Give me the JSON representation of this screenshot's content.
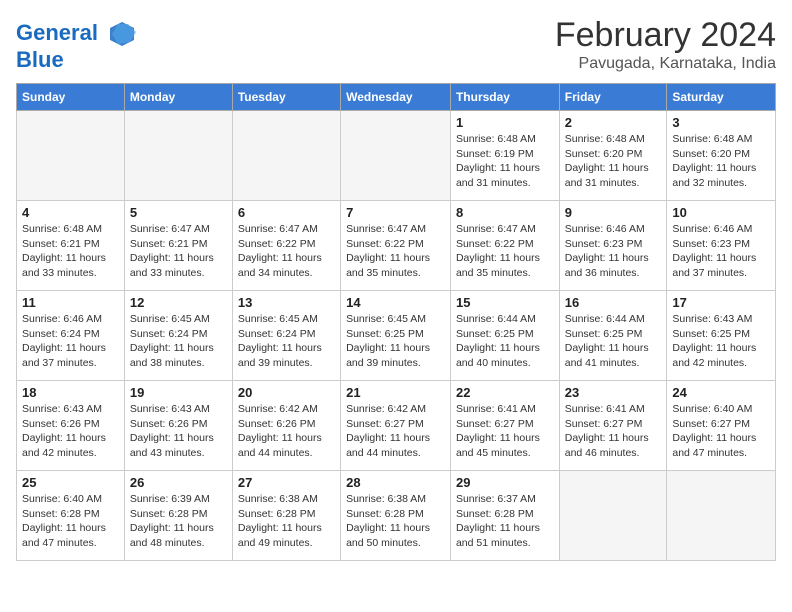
{
  "header": {
    "logo_line1": "General",
    "logo_line2": "Blue",
    "title": "February 2024",
    "subtitle": "Pavugada, Karnataka, India"
  },
  "days_of_week": [
    "Sunday",
    "Monday",
    "Tuesday",
    "Wednesday",
    "Thursday",
    "Friday",
    "Saturday"
  ],
  "weeks": [
    [
      {
        "day": "",
        "info": ""
      },
      {
        "day": "",
        "info": ""
      },
      {
        "day": "",
        "info": ""
      },
      {
        "day": "",
        "info": ""
      },
      {
        "day": "1",
        "info": "Sunrise: 6:48 AM\nSunset: 6:19 PM\nDaylight: 11 hours and 31 minutes."
      },
      {
        "day": "2",
        "info": "Sunrise: 6:48 AM\nSunset: 6:20 PM\nDaylight: 11 hours and 31 minutes."
      },
      {
        "day": "3",
        "info": "Sunrise: 6:48 AM\nSunset: 6:20 PM\nDaylight: 11 hours and 32 minutes."
      }
    ],
    [
      {
        "day": "4",
        "info": "Sunrise: 6:48 AM\nSunset: 6:21 PM\nDaylight: 11 hours and 33 minutes."
      },
      {
        "day": "5",
        "info": "Sunrise: 6:47 AM\nSunset: 6:21 PM\nDaylight: 11 hours and 33 minutes."
      },
      {
        "day": "6",
        "info": "Sunrise: 6:47 AM\nSunset: 6:22 PM\nDaylight: 11 hours and 34 minutes."
      },
      {
        "day": "7",
        "info": "Sunrise: 6:47 AM\nSunset: 6:22 PM\nDaylight: 11 hours and 35 minutes."
      },
      {
        "day": "8",
        "info": "Sunrise: 6:47 AM\nSunset: 6:22 PM\nDaylight: 11 hours and 35 minutes."
      },
      {
        "day": "9",
        "info": "Sunrise: 6:46 AM\nSunset: 6:23 PM\nDaylight: 11 hours and 36 minutes."
      },
      {
        "day": "10",
        "info": "Sunrise: 6:46 AM\nSunset: 6:23 PM\nDaylight: 11 hours and 37 minutes."
      }
    ],
    [
      {
        "day": "11",
        "info": "Sunrise: 6:46 AM\nSunset: 6:24 PM\nDaylight: 11 hours and 37 minutes."
      },
      {
        "day": "12",
        "info": "Sunrise: 6:45 AM\nSunset: 6:24 PM\nDaylight: 11 hours and 38 minutes."
      },
      {
        "day": "13",
        "info": "Sunrise: 6:45 AM\nSunset: 6:24 PM\nDaylight: 11 hours and 39 minutes."
      },
      {
        "day": "14",
        "info": "Sunrise: 6:45 AM\nSunset: 6:25 PM\nDaylight: 11 hours and 39 minutes."
      },
      {
        "day": "15",
        "info": "Sunrise: 6:44 AM\nSunset: 6:25 PM\nDaylight: 11 hours and 40 minutes."
      },
      {
        "day": "16",
        "info": "Sunrise: 6:44 AM\nSunset: 6:25 PM\nDaylight: 11 hours and 41 minutes."
      },
      {
        "day": "17",
        "info": "Sunrise: 6:43 AM\nSunset: 6:25 PM\nDaylight: 11 hours and 42 minutes."
      }
    ],
    [
      {
        "day": "18",
        "info": "Sunrise: 6:43 AM\nSunset: 6:26 PM\nDaylight: 11 hours and 42 minutes."
      },
      {
        "day": "19",
        "info": "Sunrise: 6:43 AM\nSunset: 6:26 PM\nDaylight: 11 hours and 43 minutes."
      },
      {
        "day": "20",
        "info": "Sunrise: 6:42 AM\nSunset: 6:26 PM\nDaylight: 11 hours and 44 minutes."
      },
      {
        "day": "21",
        "info": "Sunrise: 6:42 AM\nSunset: 6:27 PM\nDaylight: 11 hours and 44 minutes."
      },
      {
        "day": "22",
        "info": "Sunrise: 6:41 AM\nSunset: 6:27 PM\nDaylight: 11 hours and 45 minutes."
      },
      {
        "day": "23",
        "info": "Sunrise: 6:41 AM\nSunset: 6:27 PM\nDaylight: 11 hours and 46 minutes."
      },
      {
        "day": "24",
        "info": "Sunrise: 6:40 AM\nSunset: 6:27 PM\nDaylight: 11 hours and 47 minutes."
      }
    ],
    [
      {
        "day": "25",
        "info": "Sunrise: 6:40 AM\nSunset: 6:28 PM\nDaylight: 11 hours and 47 minutes."
      },
      {
        "day": "26",
        "info": "Sunrise: 6:39 AM\nSunset: 6:28 PM\nDaylight: 11 hours and 48 minutes."
      },
      {
        "day": "27",
        "info": "Sunrise: 6:38 AM\nSunset: 6:28 PM\nDaylight: 11 hours and 49 minutes."
      },
      {
        "day": "28",
        "info": "Sunrise: 6:38 AM\nSunset: 6:28 PM\nDaylight: 11 hours and 50 minutes."
      },
      {
        "day": "29",
        "info": "Sunrise: 6:37 AM\nSunset: 6:28 PM\nDaylight: 11 hours and 51 minutes."
      },
      {
        "day": "",
        "info": ""
      },
      {
        "day": "",
        "info": ""
      }
    ]
  ]
}
